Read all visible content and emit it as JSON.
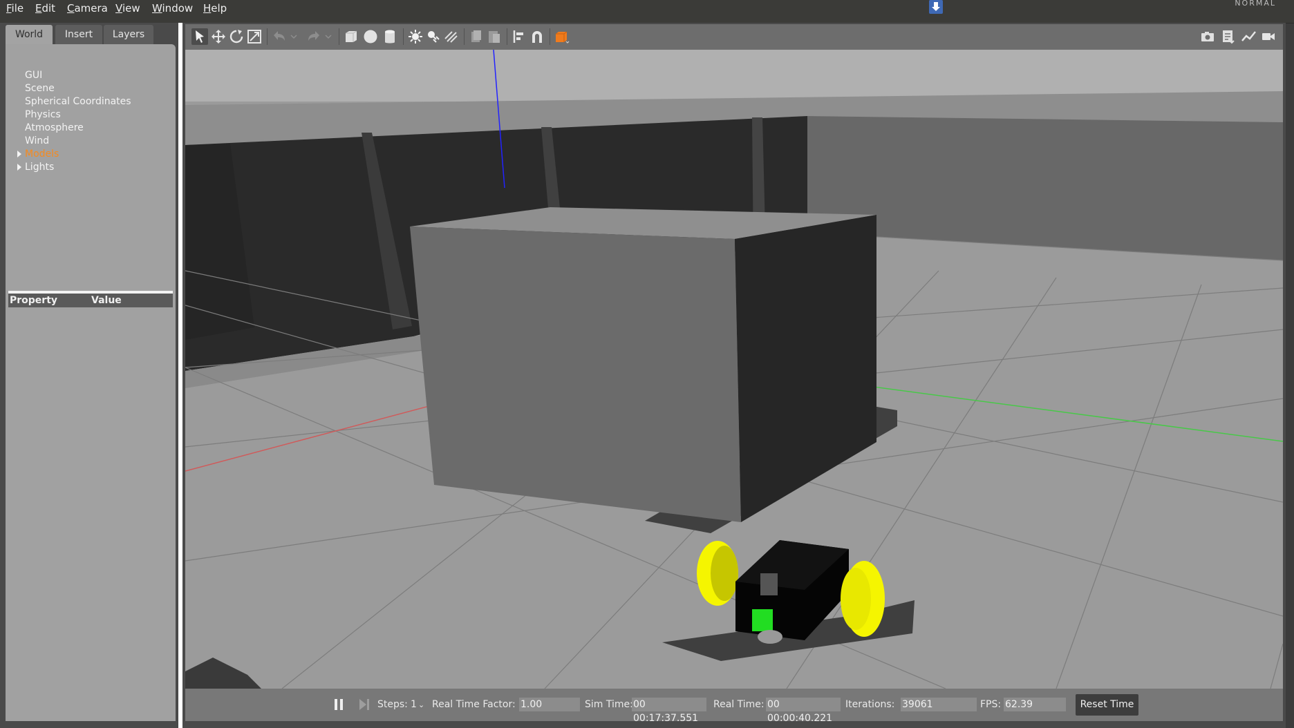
{
  "menubar": {
    "items": [
      "File",
      "Edit",
      "Camera",
      "View",
      "Window",
      "Help"
    ],
    "mode": "NORMAL"
  },
  "left_panel": {
    "tabs": [
      "World",
      "Insert",
      "Layers"
    ],
    "active_tab": "World",
    "tree": [
      {
        "label": "GUI"
      },
      {
        "label": "Scene"
      },
      {
        "label": "Spherical Coordinates"
      },
      {
        "label": "Physics"
      },
      {
        "label": "Atmosphere"
      },
      {
        "label": "Wind"
      },
      {
        "label": "Models",
        "expandable": true,
        "highlight": true
      },
      {
        "label": "Lights",
        "expandable": true
      }
    ],
    "property_header": {
      "property": "Property",
      "value": "Value"
    }
  },
  "toolbar": {
    "left_icons": [
      "select-arrow-icon",
      "translate-icon",
      "rotate-icon",
      "scale-icon",
      "undo-icon",
      "undo-history-icon",
      "redo-icon",
      "redo-history-icon",
      "box-shape-icon",
      "sphere-shape-icon",
      "cylinder-shape-icon",
      "point-light-icon",
      "spot-light-icon",
      "directional-light-icon",
      "copy-icon",
      "paste-icon",
      "align-icon",
      "snap-magnet-icon",
      "view-angle-icon"
    ],
    "right_icons": [
      "screenshot-icon",
      "log-icon",
      "plot-icon",
      "video-record-icon"
    ]
  },
  "status": {
    "steps_label": "Steps:",
    "steps_value": "1",
    "rtf_label": "Real Time Factor:",
    "rtf_value": "1.00",
    "sim_time_label": "Sim Time:",
    "sim_time_value": "00 00:17:37.551",
    "real_time_label": "Real Time:",
    "real_time_value": "00 00:00:40.221",
    "iterations_label": "Iterations:",
    "iterations_value": "39061",
    "fps_label": "FPS:",
    "fps_value": "62.39",
    "reset_label": "Reset Time"
  },
  "colors": {
    "accent_orange": "#f58a1f",
    "robot_wheels": "#f5f500",
    "robot_body": "#050505",
    "robot_sensor": "#22dd22",
    "axis_x": "#d05a5a",
    "axis_y": "#48c848",
    "axis_z": "#2222ff"
  }
}
